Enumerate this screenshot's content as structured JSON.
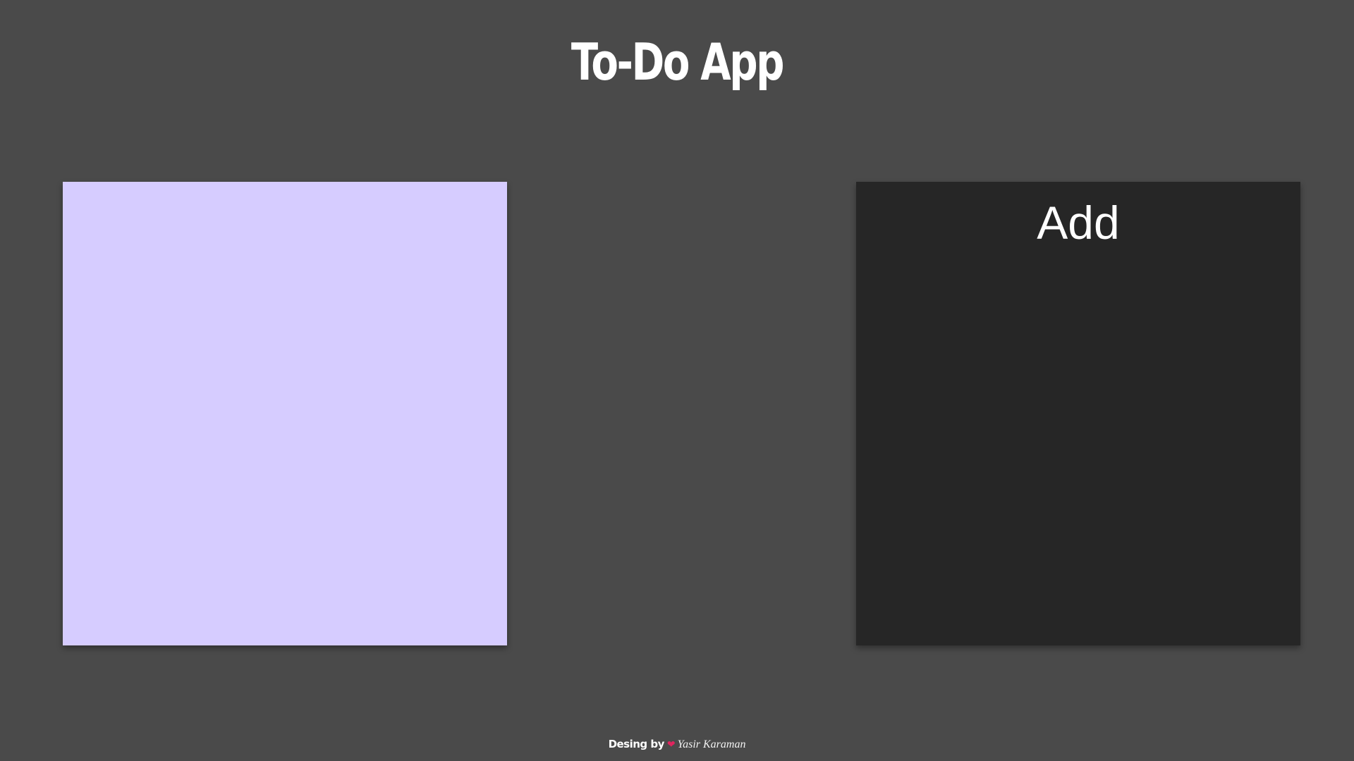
{
  "header": {
    "title": "To-Do App"
  },
  "note_list": {
    "background": "#d6ccff"
  },
  "add_panel": {
    "label": "Add",
    "background": "#262626"
  },
  "footer": {
    "prefix": "Desing by",
    "heart_icon": "heart-icon",
    "author": "Yasir Karaman"
  },
  "colors": {
    "page_background": "#4a4a4a",
    "text": "#ffffff",
    "heart": "#e0245e"
  }
}
